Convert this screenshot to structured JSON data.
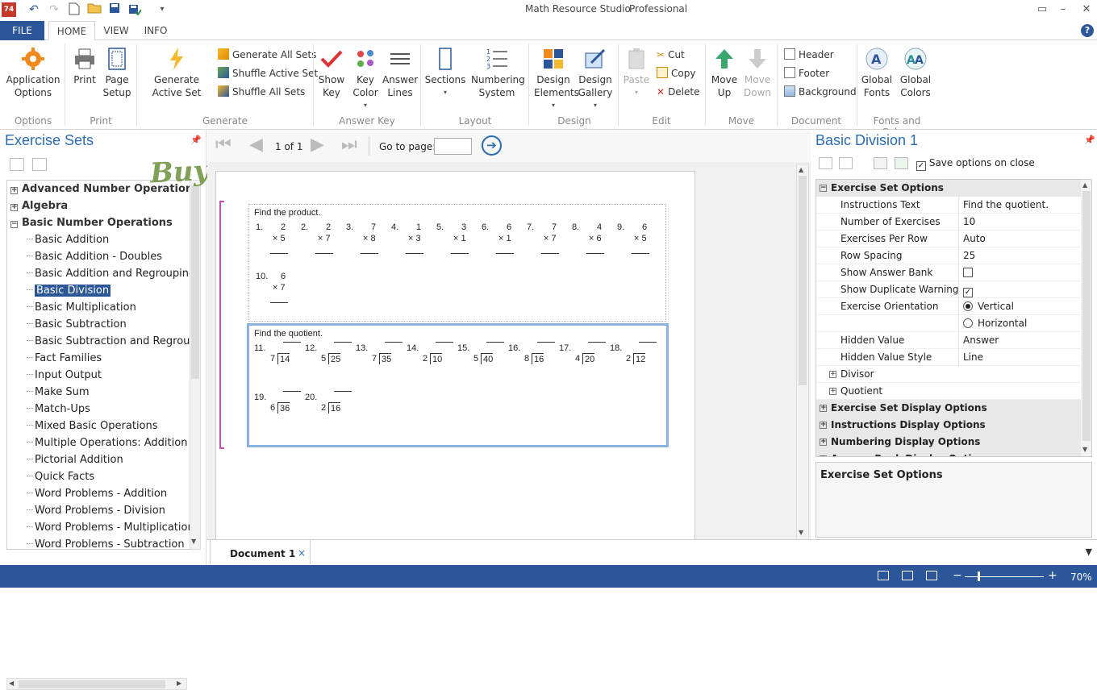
{
  "app": {
    "title": "Math Resource Studio",
    "edition": "Professional",
    "icon_text": "74"
  },
  "tabs": {
    "file": "FILE",
    "home": "HOME",
    "view": "VIEW",
    "info": "INFO"
  },
  "ribbon": {
    "options": {
      "app_options": "Application Options",
      "group": "Options"
    },
    "print": {
      "print": "Print",
      "page_setup": "Page Setup",
      "group": "Print"
    },
    "generate": {
      "generate_active": "Generate Active Set",
      "generate_all": "Generate All Sets",
      "shuffle_active": "Shuffle Active Set",
      "shuffle_all": "Shuffle All Sets",
      "group": "Generate"
    },
    "answer_key": {
      "show_key": "Show Key",
      "key_color": "Key Color",
      "answer_lines": "Answer Lines",
      "group": "Answer Key"
    },
    "layout": {
      "sections": "Sections",
      "numbering": "Numbering System",
      "group": "Layout"
    },
    "design": {
      "elements": "Design Elements",
      "gallery": "Design Gallery",
      "group": "Design"
    },
    "edit": {
      "paste": "Paste",
      "cut": "Cut",
      "copy": "Copy",
      "delete": "Delete",
      "group": "Edit"
    },
    "move": {
      "up": "Move Up",
      "down": "Move Down",
      "group": "Move"
    },
    "document": {
      "header": "Header",
      "footer": "Footer",
      "background": "Background",
      "group": "Document"
    },
    "fonts_colors": {
      "fonts": "Global Fonts",
      "colors": "Global Colors",
      "group": "Fonts and Colors"
    }
  },
  "left_panel": {
    "title": "Exercise Sets",
    "tree": [
      {
        "label": "Advanced Number Operations",
        "level": 0,
        "exp": "+"
      },
      {
        "label": "Algebra",
        "level": 0,
        "exp": "+"
      },
      {
        "label": "Basic Number Operations",
        "level": 0,
        "exp": "−"
      },
      {
        "label": "Basic Addition",
        "level": 1
      },
      {
        "label": "Basic Addition - Doubles",
        "level": 1
      },
      {
        "label": "Basic Addition and Regrouping",
        "level": 1
      },
      {
        "label": "Basic Division",
        "level": 1,
        "selected": true
      },
      {
        "label": "Basic Multiplication",
        "level": 1
      },
      {
        "label": "Basic Subtraction",
        "level": 1
      },
      {
        "label": "Basic Subtraction and Regroupin",
        "level": 1
      },
      {
        "label": "Fact Families",
        "level": 1
      },
      {
        "label": "Input Output",
        "level": 1
      },
      {
        "label": "Make Sum",
        "level": 1
      },
      {
        "label": "Match-Ups",
        "level": 1
      },
      {
        "label": "Mixed Basic Operations",
        "level": 1
      },
      {
        "label": "Multiple Operations: Addition Su",
        "level": 1
      },
      {
        "label": "Pictorial Addition",
        "level": 1
      },
      {
        "label": "Quick Facts",
        "level": 1
      },
      {
        "label": "Word Problems - Addition",
        "level": 1
      },
      {
        "label": "Word Problems - Division",
        "level": 1
      },
      {
        "label": "Word Problems - Multiplication",
        "level": 1
      },
      {
        "label": "Word Problems - Subtraction",
        "level": 1
      }
    ]
  },
  "navigator": {
    "page_of": "1 of 1",
    "goto_label": "Go to page:"
  },
  "worksheet": {
    "section1_title": "Find the product.",
    "multiplication": [
      {
        "n": "1.",
        "a": "2",
        "b": "× 5"
      },
      {
        "n": "2.",
        "a": "2",
        "b": "× 7"
      },
      {
        "n": "3.",
        "a": "7",
        "b": "× 8"
      },
      {
        "n": "4.",
        "a": "1",
        "b": "× 3"
      },
      {
        "n": "5.",
        "a": "3",
        "b": "× 1"
      },
      {
        "n": "6.",
        "a": "6",
        "b": "× 1"
      },
      {
        "n": "7.",
        "a": "7",
        "b": "× 7"
      },
      {
        "n": "8.",
        "a": "4",
        "b": "× 6"
      },
      {
        "n": "9.",
        "a": "6",
        "b": "× 5"
      },
      {
        "n": "10.",
        "a": "6",
        "b": "× 7"
      }
    ],
    "section2_title": "Find the quotient.",
    "division": [
      {
        "n": "11.",
        "d": "7",
        "q": "14"
      },
      {
        "n": "12.",
        "d": "5",
        "q": "25"
      },
      {
        "n": "13.",
        "d": "7",
        "q": "35"
      },
      {
        "n": "14.",
        "d": "2",
        "q": "10"
      },
      {
        "n": "15.",
        "d": "5",
        "q": "40"
      },
      {
        "n": "16.",
        "d": "8",
        "q": "16"
      },
      {
        "n": "17.",
        "d": "4",
        "q": "20"
      },
      {
        "n": "18.",
        "d": "2",
        "q": "12"
      },
      {
        "n": "19.",
        "d": "6",
        "q": "36"
      },
      {
        "n": "20.",
        "d": "2",
        "q": "16"
      }
    ]
  },
  "doc_tab": {
    "label": "Document 1",
    "close": "×"
  },
  "right_panel": {
    "title": "Basic Division 1",
    "save_options": "Save options on close",
    "rows": [
      {
        "type": "cat",
        "name": "Exercise Set Options",
        "exp": "−"
      },
      {
        "type": "prop",
        "name": "Instructions Text",
        "value": "Find the quotient."
      },
      {
        "type": "prop",
        "name": "Number of Exercises",
        "value": "10"
      },
      {
        "type": "prop",
        "name": "Exercises Per Row",
        "value": "Auto"
      },
      {
        "type": "prop",
        "name": "Row Spacing",
        "value": "25"
      },
      {
        "type": "check",
        "name": "Show Answer Bank",
        "value": ""
      },
      {
        "type": "check",
        "name": "Show Duplicate Warning",
        "value": "✓"
      },
      {
        "type": "radio",
        "name": "Exercise Orientation",
        "value": "Vertical",
        "on": true
      },
      {
        "type": "radio",
        "name": "",
        "value": "Horizontal",
        "on": false
      },
      {
        "type": "prop",
        "name": "Hidden Value",
        "value": "Answer"
      },
      {
        "type": "prop",
        "name": "Hidden Value Style",
        "value": "Line"
      },
      {
        "type": "sub",
        "name": "Divisor",
        "exp": "+"
      },
      {
        "type": "sub",
        "name": "Quotient",
        "exp": "+"
      },
      {
        "type": "cat",
        "name": "Exercise Set Display Options",
        "exp": "+"
      },
      {
        "type": "cat",
        "name": "Instructions Display Options",
        "exp": "+"
      },
      {
        "type": "cat",
        "name": "Numbering Display Options",
        "exp": "+"
      },
      {
        "type": "cat",
        "name": "Answer Bank Display Options",
        "exp": "+"
      }
    ],
    "description_title": "Exercise Set Options"
  },
  "status": {
    "zoom": "70%"
  },
  "watermark": "BuyHAaMe",
  "colors": {
    "accent": "#2b579a",
    "selection_border": "#8ab4e0",
    "panel_title": "#2b6cb0"
  }
}
